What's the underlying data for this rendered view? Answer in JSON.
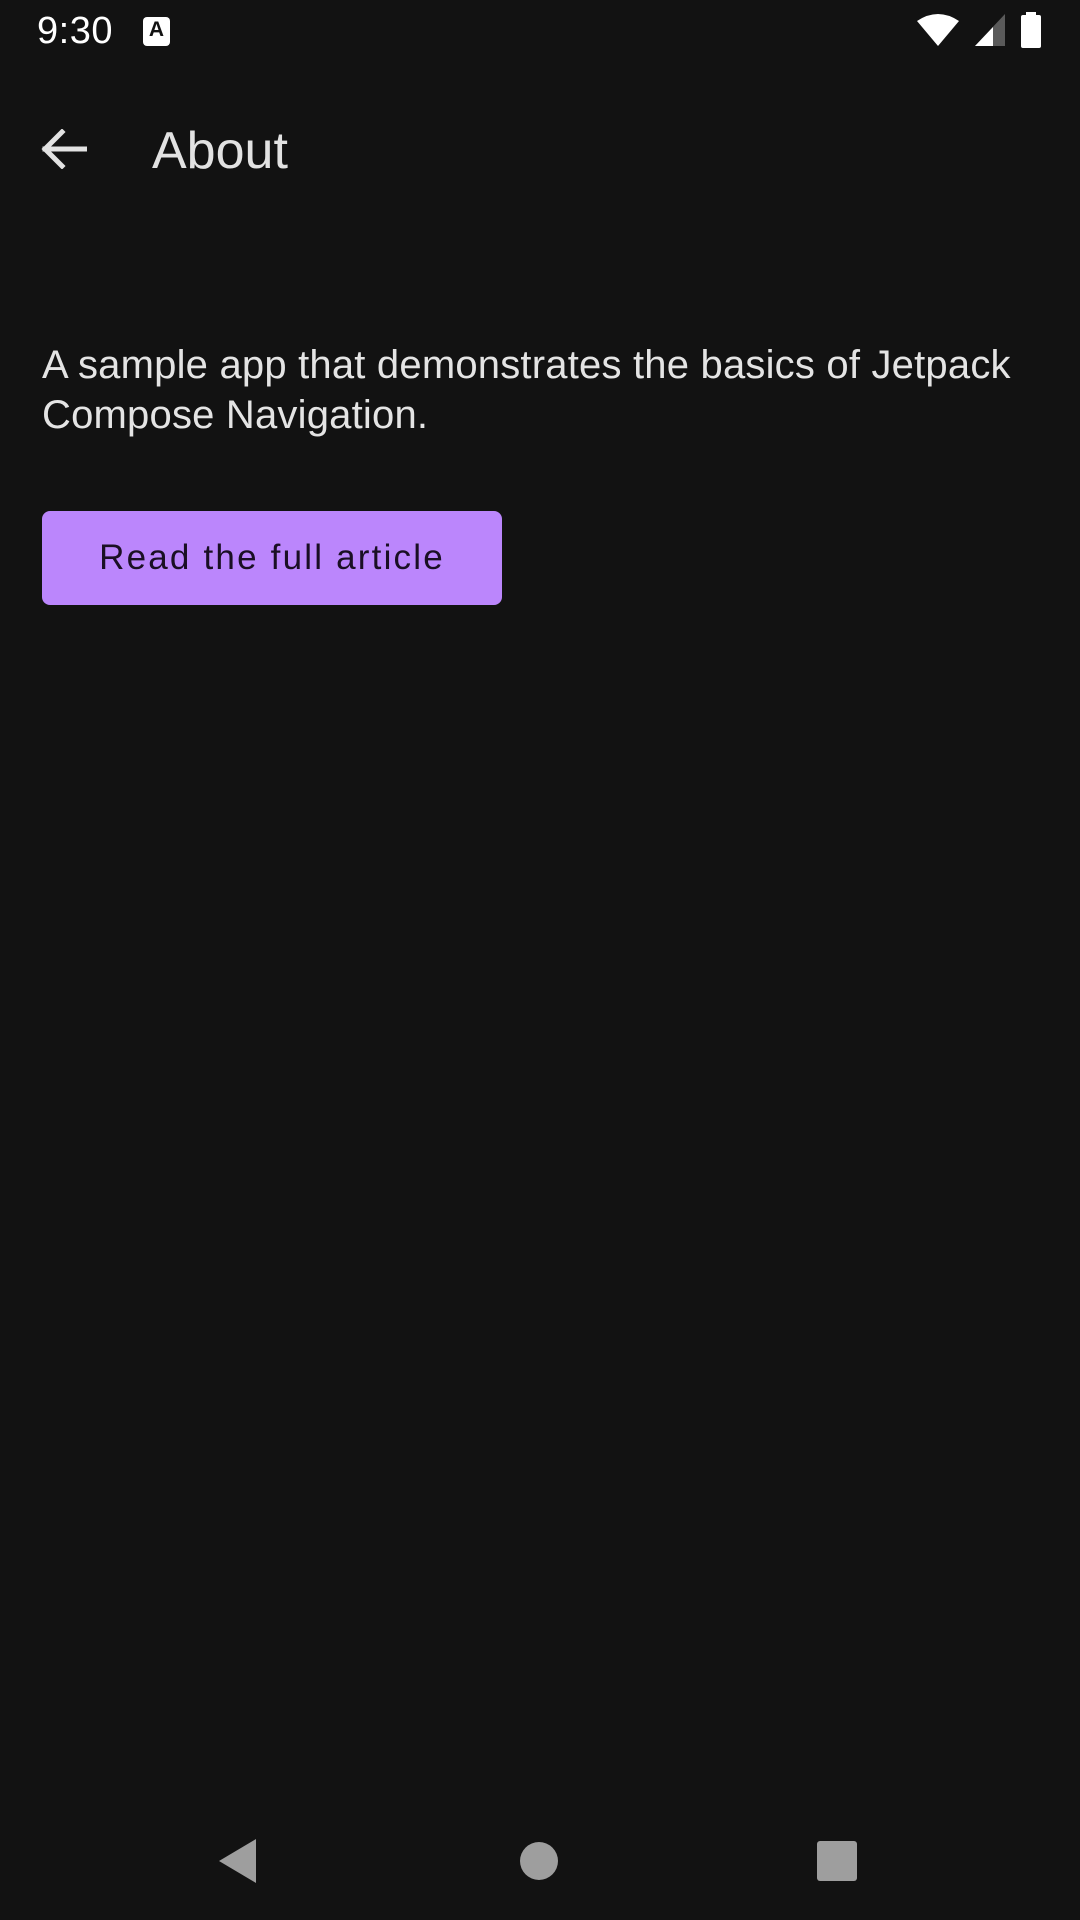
{
  "status_bar": {
    "time": "9:30",
    "notification_icon": "a-icon",
    "notification_letter": "A",
    "wifi_icon": "wifi-icon",
    "signal_icon": "cellular-signal-icon",
    "battery_icon": "battery-icon"
  },
  "app_bar": {
    "back_icon": "arrow-back-icon",
    "title": "About"
  },
  "content": {
    "description": "A sample app that demonstrates the basics of Jetpack Compose Navigation.",
    "button_label": "Read the full article"
  },
  "nav_bar": {
    "back_icon": "nav-back-icon",
    "home_icon": "nav-home-icon",
    "recents_icon": "nav-recents-icon"
  },
  "colors": {
    "background": "#121212",
    "primary": "#bb86fc",
    "on_primary": "#1a0f24",
    "text": "#e0e0e0",
    "nav_icon": "#9e9e9e"
  }
}
